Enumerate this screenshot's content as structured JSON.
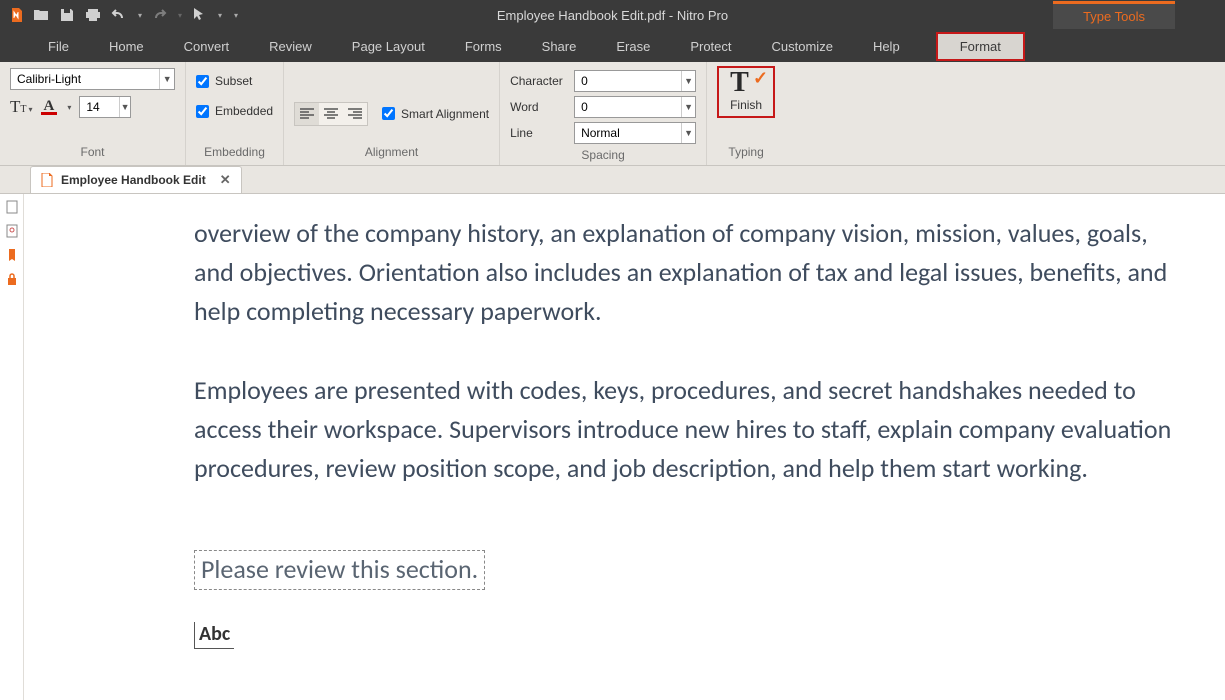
{
  "title": "Employee Handbook Edit.pdf - Nitro Pro",
  "contextual_tab": "Type Tools",
  "menu": [
    "File",
    "Home",
    "Convert",
    "Review",
    "Page Layout",
    "Forms",
    "Share",
    "Erase",
    "Protect",
    "Customize",
    "Help",
    "Format"
  ],
  "ribbon": {
    "font": {
      "name": "Calibri-Light",
      "size": "14",
      "group_label": "Font"
    },
    "embedding": {
      "subset_label": "Subset",
      "embedded_label": "Embedded",
      "group_label": "Embedding"
    },
    "alignment": {
      "smart_label": "Smart Alignment",
      "group_label": "Alignment"
    },
    "spacing": {
      "character_label": "Character",
      "character_val": "0",
      "word_label": "Word",
      "word_val": "0",
      "line_label": "Line",
      "line_val": "Normal",
      "group_label": "Spacing"
    },
    "typing": {
      "finish_label": "Finish",
      "group_label": "Typing"
    }
  },
  "tab": {
    "name": "Employee Handbook Edit"
  },
  "document": {
    "p1": "overview of the company history, an explanation of company vision, mission, values, goals, and objectives. Orientation also includes an explanation of tax and legal issues, benefits, and help completing necessary paperwork.",
    "p2": "Employees are presented with codes, keys, procedures, and secret handshakes needed to access their workspace. Supervisors introduce new hires to staff, explain company evaluation procedures, review position scope, and job description, and help them start working.",
    "comment": "Please review this section.",
    "placeholder": "Abc"
  }
}
